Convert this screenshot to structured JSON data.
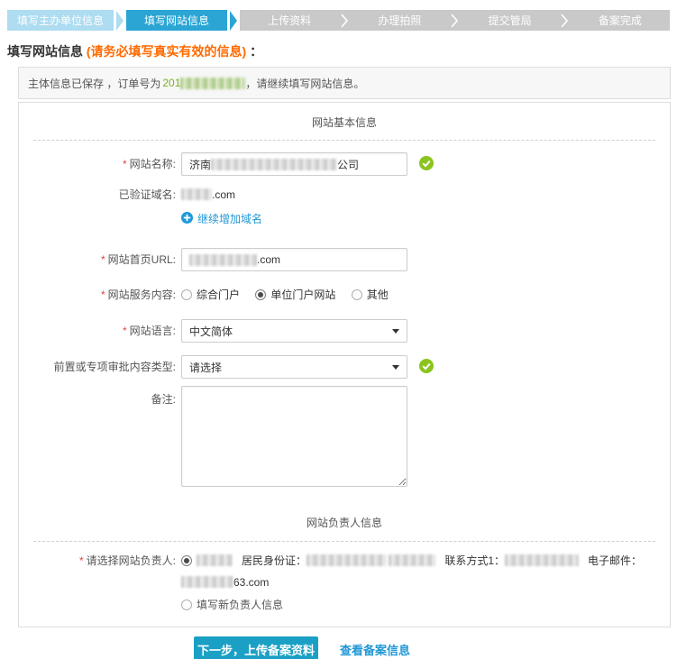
{
  "steps": [
    {
      "label": "填写主办单位信息",
      "state": "done"
    },
    {
      "label": "填写网站信息",
      "state": "active"
    },
    {
      "label": "上传资料",
      "state": "pending"
    },
    {
      "label": "办理拍照",
      "state": "pending"
    },
    {
      "label": "提交管局",
      "state": "pending"
    },
    {
      "label": "备案完成",
      "state": "pending"
    }
  ],
  "page": {
    "title": "填写网站信息",
    "title_note": "(请务必填写真实有效的信息)",
    "title_colon": "："
  },
  "notice": {
    "prefix": "主体信息已保存 ，订单号为",
    "order_prefix": "201",
    "suffix": "，请继续填写网站信息。"
  },
  "form": {
    "required_mark": "*",
    "section1_title": "网站基本信息",
    "site_name": {
      "label": "网站名称:",
      "value_prefix": "济南",
      "value_suffix": "公司"
    },
    "verified_domain": {
      "label": "已验证域名:",
      "value_suffix": ".com"
    },
    "add_domain": {
      "icon": "plus-circle-icon",
      "label": "继续增加域名"
    },
    "site_url": {
      "label": "网站首页URL:",
      "value_suffix": ".com"
    },
    "service": {
      "label": "网站服务内容:",
      "options": [
        {
          "label": "综合门户",
          "checked": false
        },
        {
          "label": "单位门户网站",
          "checked": true
        },
        {
          "label": "其他",
          "checked": false
        }
      ],
      "selected": "单位门户网站"
    },
    "language": {
      "label": "网站语言:",
      "value": "中文简体"
    },
    "approval": {
      "label": "前置或专项审批内容类型:",
      "value": "请选择"
    },
    "remark": {
      "label": "备注:",
      "value": ""
    },
    "section2_title": "网站负责人信息",
    "owner": {
      "label": "请选择网站负责人:",
      "id_label": "居民身份证：",
      "contact_label": "联系方式1：",
      "email_label": "电子邮件：",
      "email_suffix": "63.com",
      "new_option": "填写新负责人信息",
      "selected": "existing"
    }
  },
  "actions": {
    "next": "下一步，上传备案资料",
    "view": "查看备案信息"
  },
  "colors": {
    "step_done": "#aedcf1",
    "step_active": "#2aa5d4",
    "step_pending": "#c9c9c9",
    "link_blue": "#2298d5",
    "button_blue": "#1ba0c5",
    "check_green": "#8bc41e",
    "note_orange": "#ff6a00",
    "order_green": "#7cae23"
  }
}
